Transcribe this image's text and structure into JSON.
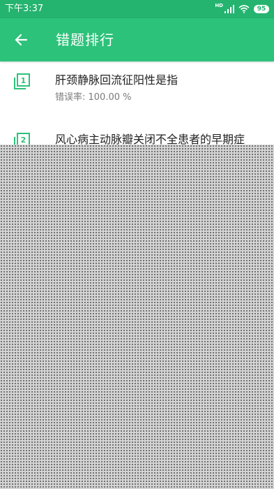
{
  "status_bar": {
    "time": "下午3:37",
    "network_label": "HD",
    "battery_level": "95"
  },
  "app_bar": {
    "title": "错题排行"
  },
  "questions": [
    {
      "rank": "1",
      "title": "肝颈静脉回流征阳性是指",
      "error_rate": "错误率: 100.00 %"
    },
    {
      "rank": "2",
      "title": "风心病主动脉瓣关闭不全患者的早期症",
      "error_rate": ""
    }
  ],
  "colors": {
    "status_bar": "#24b46f",
    "app_bar": "#2cc27a",
    "accent": "#2cc27a",
    "overlay": "#d4d4d4"
  }
}
